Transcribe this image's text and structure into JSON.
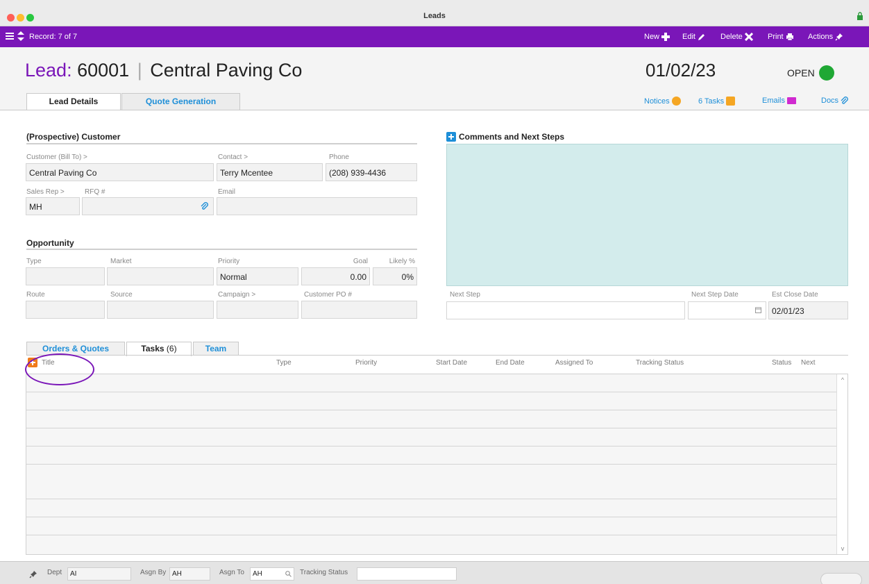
{
  "window": {
    "title": "Leads"
  },
  "toolbar": {
    "record": "Record: 7 of 7",
    "new": "New",
    "edit": "Edit",
    "delete": "Delete",
    "print": "Print",
    "actions": "Actions"
  },
  "header": {
    "lead_label": "Lead:",
    "lead_number": "60001",
    "separator": "|",
    "company": "Central Paving Co",
    "date": "01/02/23",
    "status": "OPEN",
    "status_color": "#1fa834"
  },
  "tabs": [
    "Lead Details",
    "Quote Generation"
  ],
  "links": {
    "notices": "Notices",
    "tasks": "6 Tasks",
    "emails": "Emails",
    "docs": "Docs"
  },
  "customer": {
    "section_title": "(Prospective) Customer",
    "bill_to_label": "Customer (Bill To) >",
    "bill_to": "Central Paving Co",
    "contact_label": "Contact >",
    "contact": "Terry Mcentee",
    "phone_label": "Phone",
    "phone": "(208) 939-4436",
    "sales_rep_label": "Sales Rep >",
    "sales_rep": "MH",
    "rfq_label": "RFQ #",
    "rfq": "",
    "email_label": "Email",
    "email": ""
  },
  "opportunity": {
    "section_title": "Opportunity",
    "type_label": "Type",
    "market_label": "Market",
    "priority_label": "Priority",
    "priority": "Normal",
    "goal_label": "Goal",
    "goal": "0.00",
    "likely_label": "Likely %",
    "likely": "0%",
    "route_label": "Route",
    "source_label": "Source",
    "campaign_label": "Campaign >",
    "customer_po_label": "Customer PO #"
  },
  "comments": {
    "section_title": "Comments and Next Steps",
    "next_step_label": "Next Step",
    "next_step": "",
    "next_step_date_label": "Next Step Date",
    "est_close_label": "Est Close Date",
    "est_close": "02/01/23"
  },
  "sub_tabs": {
    "orders": "Orders & Quotes",
    "tasks": "Tasks",
    "tasks_count": "(6)",
    "team": "Team"
  },
  "grid": {
    "columns": [
      "Title",
      "Type",
      "Priority",
      "Start Date",
      "End Date",
      "Assigned To",
      "Tracking Status",
      "Status",
      "Next"
    ]
  },
  "footer": {
    "dept_label": "Dept",
    "dept": "AI",
    "asgn_by_label": "Asgn By",
    "asgn_by": "AH",
    "asgn_to_label": "Asgn To",
    "asgn_to": "AH",
    "tracking_label": "Tracking Status",
    "tracking": ""
  },
  "colors": {
    "brand": "#7a16b8",
    "link": "#1e8fd8",
    "comments_bg": "#d3ecec"
  }
}
